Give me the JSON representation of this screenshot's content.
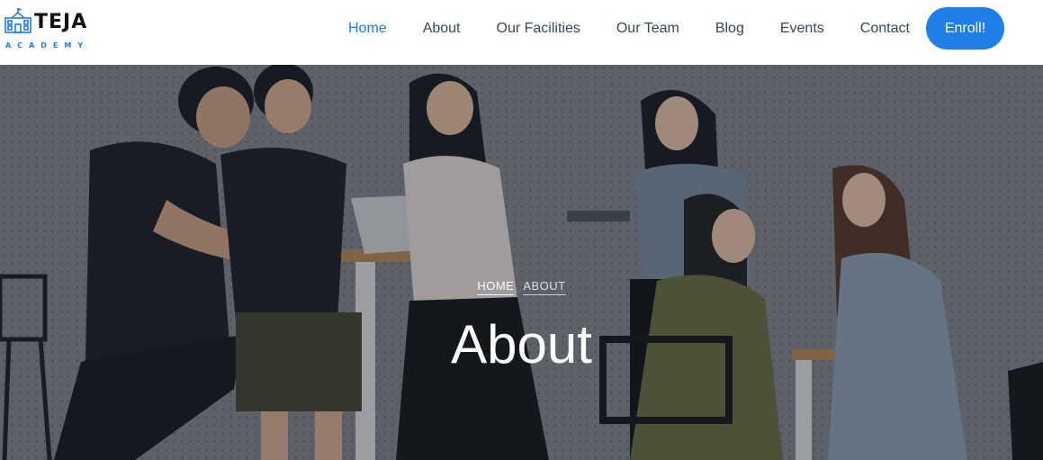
{
  "brand": {
    "title": "TEJA",
    "subtitle": "ACADEMY",
    "accent": "#1e7fe6"
  },
  "nav": {
    "items": [
      {
        "label": "Home",
        "active": true
      },
      {
        "label": "About",
        "active": false
      },
      {
        "label": "Our Facilities",
        "active": false
      },
      {
        "label": "Our Team",
        "active": false
      },
      {
        "label": "Blog",
        "active": false
      },
      {
        "label": "Events",
        "active": false
      },
      {
        "label": "Contact",
        "active": false
      }
    ],
    "cta_label": "Enroll!"
  },
  "hero": {
    "breadcrumb": {
      "home": "HOME",
      "current": "ABOUT"
    },
    "title": "About"
  }
}
